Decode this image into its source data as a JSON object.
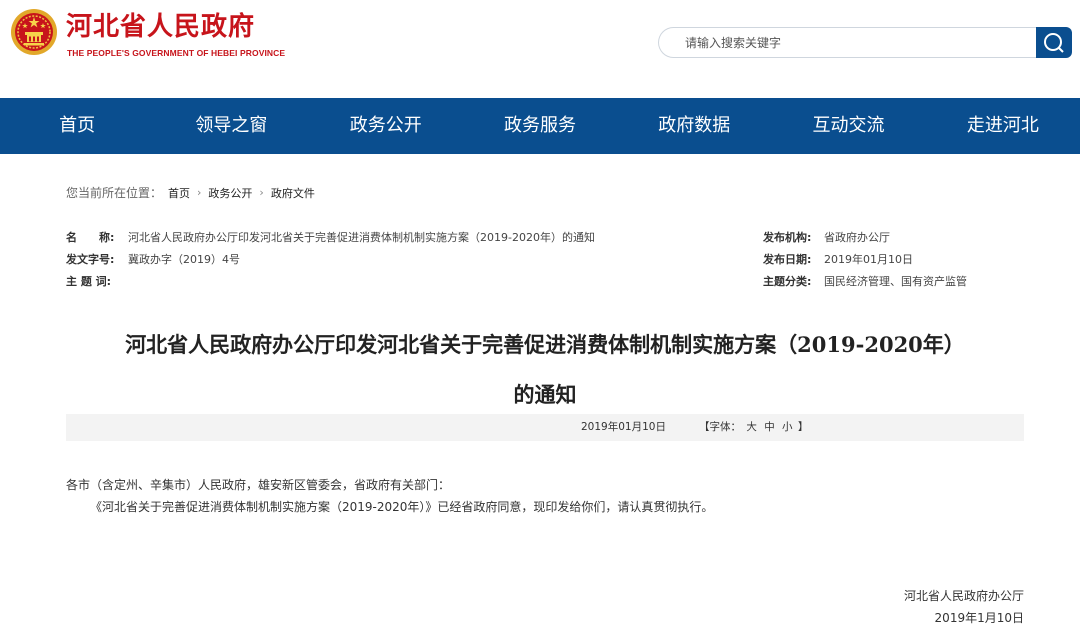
{
  "header": {
    "title": "河北省人民政府",
    "subtitle": "THE PEOPLE'S GOVERNMENT OF HEBEI PROVINCE",
    "search_placeholder": "请输入搜索关键字",
    "brand_color": "#c7141b",
    "nav_color": "#0a4e8f"
  },
  "nav": {
    "items": [
      "首页",
      "领导之窗",
      "政务公开",
      "政务服务",
      "政府数据",
      "互动交流",
      "走进河北"
    ]
  },
  "breadcrumb": {
    "label": "您当前所在位置：",
    "items": [
      "首页",
      "政务公开",
      "政府文件"
    ]
  },
  "meta": {
    "name_label": "名　　称:",
    "name_value": "河北省人民政府办公厅印发河北省关于完善促进消费体制机制实施方案（2019-2020年）的通知",
    "doc_no_label": "发文字号:",
    "doc_no_value": "冀政办字（2019）4号",
    "keywords_label": "主 题 词:",
    "keywords_value": "",
    "publisher_label": "发布机构:",
    "publisher_value": "省政府办公厅",
    "date_label": "发布日期:",
    "date_value": "2019年01月10日",
    "category_label": "主题分类:",
    "category_value": "国民经济管理、国有资产监管"
  },
  "article": {
    "title_line1": "河北省人民政府办公厅印发河北省关于完善促进消费体制机制实施方案（2019-2020年）",
    "title_line2": "的通知",
    "date": "2019年01月10日",
    "font_open": "【字体：",
    "font_large": "大",
    "font_medium": "中",
    "font_small": "小",
    "font_close": "】",
    "para1": "各市（含定州、辛集市）人民政府，雄安新区管委会，省政府有关部门：",
    "para2": "《河北省关于完善促进消费体制机制实施方案（2019-2020年）》已经省政府同意，现印发给你们，请认真贯彻执行。",
    "sign_org": "河北省人民政府办公厅",
    "sign_date": "2019年1月10日"
  }
}
